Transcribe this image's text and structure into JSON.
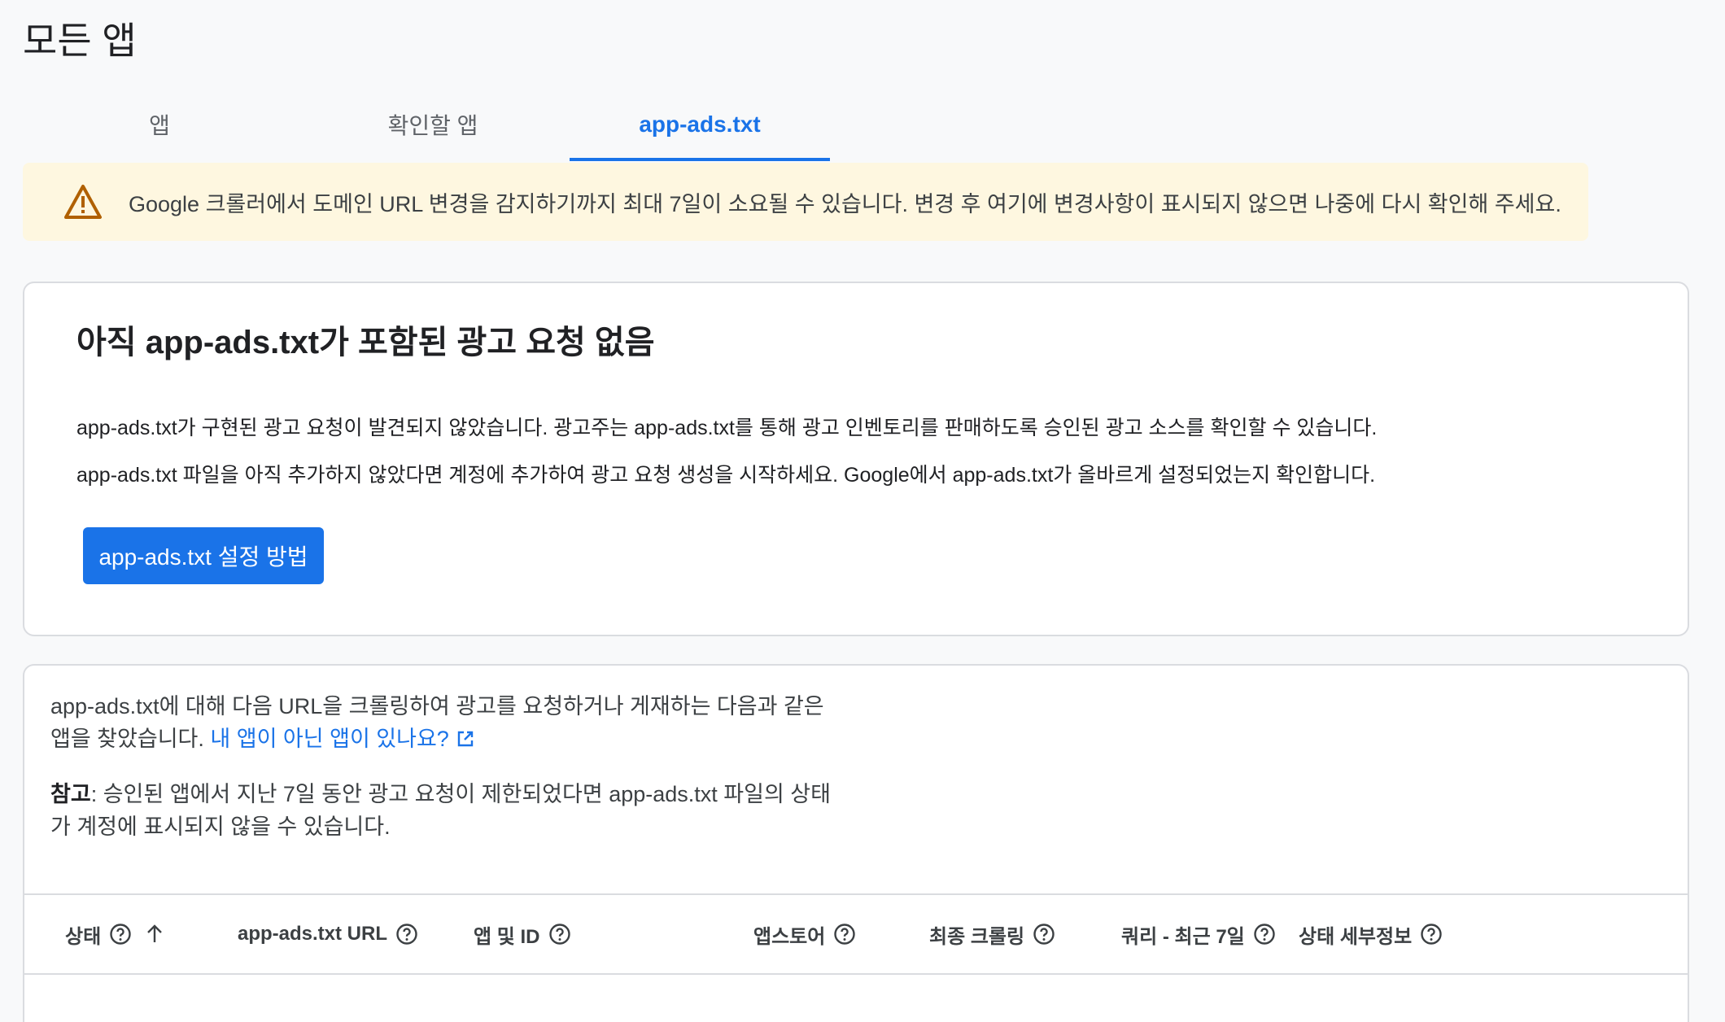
{
  "page": {
    "title": "모든 앱"
  },
  "tabs": [
    {
      "label": "앱"
    },
    {
      "label": "확인할 앱"
    },
    {
      "label": "app-ads.txt",
      "active": true
    }
  ],
  "warning": {
    "icon": "warning-icon",
    "text": "Google 크롤러에서 도메인 URL 변경을 감지하기까지 최대 7일이 소요될 수 있습니다. 변경 후 여기에 변경사항이 표시되지 않으면 나중에 다시 확인해 주세요."
  },
  "empty_card": {
    "title": "아직 app-ads.txt가 포함된 광고 요청 없음",
    "paragraph1": "app-ads.txt가 구현된 광고 요청이 발견되지 않았습니다. 광고주는 app-ads.txt를 통해 광고 인벤토리를 판매하도록 승인된 광고 소스를 확인할 수 있습니다.",
    "paragraph2": "app-ads.txt 파일을 아직 추가하지 않았다면 계정에 추가하여 광고 요청 생성을 시작하세요. Google에서 app-ads.txt가 올바르게 설정되었는지 확인합니다.",
    "button_label": "app-ads.txt 설정 방법"
  },
  "apps_card": {
    "intro_text": "app-ads.txt에 대해 다음 URL을 크롤링하여 광고를 요청하거나 게재하는 다음과 같은 앱을 찾았습니다.",
    "intro_link": "내 앱이 아닌 앱이 있나요?",
    "note_label": "참고",
    "note_text": ": 승인된 앱에서 지난 7일 동안 광고 요청이 제한되었다면 app-ads.txt 파일의 상태가 계정에 표시되지 않을 수 있습니다."
  },
  "table": {
    "columns": [
      {
        "label": "상태",
        "sortable": true
      },
      {
        "label": "app-ads.txt URL"
      },
      {
        "label": "앱 및 ID"
      },
      {
        "label": "앱스토어"
      },
      {
        "label": "최종 크롤링"
      },
      {
        "label": "쿼리 - 최근 7일"
      },
      {
        "label": "상태 세부정보"
      }
    ]
  },
  "colors": {
    "accent": "#1a73e8",
    "warning_bg": "#fef7e0",
    "warning_icon": "#b06000"
  }
}
